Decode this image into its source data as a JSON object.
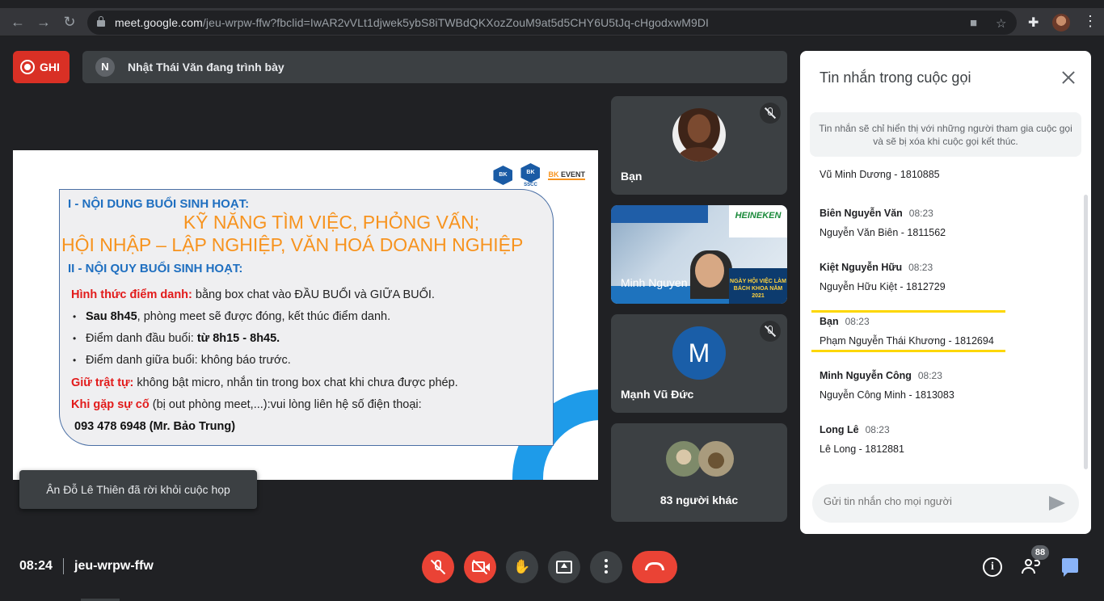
{
  "browser": {
    "url_host": "meet.google.com",
    "url_path": "/jeu-wrpw-ffw?fbclid=IwAR2vVLt1djwek5ybS8iTWBdQKXozZouM9at5d5CHY6U5tJq-cHgodxwM9DI"
  },
  "topbar": {
    "record_label": "GHI",
    "presenter_initial": "N",
    "presenter_text": "Nhật Thái Văn đang trình bày"
  },
  "slide": {
    "logo_bk": "BK",
    "logo_sscc": "SSCC",
    "logo_event_prefix": "BK",
    "logo_event_suffix": "EVENT",
    "heading1": "I - NỘI DUNG BUỔI SINH HOẠT:",
    "title_line1": "KỸ NĂNG TÌM VIỆC, PHỎNG VẤN;",
    "title_line2": "HỘI NHẬP – LẬP NGHIỆP, VĂN HOÁ DOANH NGHIỆP",
    "heading2": "II - NỘI QUY BUỔI SINH HOẠT:",
    "line1_red": "Hình thức điểm danh:",
    "line1_rest": " bằng box chat vào ĐẦU BUỔI và GIỮA BUỔI.",
    "bullet1_bold": "Sau 8h45",
    "bullet1_rest": ", phòng meet sẽ được đóng, kết thúc điểm danh.",
    "bullet2_pre": "Điểm danh đầu buổi: ",
    "bullet2_bold": "từ 8h15 - 8h45.",
    "bullet3": "Điểm danh giữa buổi: không báo trước.",
    "line2_red": "Giữ trật tự:",
    "line2_rest": " không bật micro, nhắn tin trong box chat khi chưa được phép.",
    "line3_red": "Khi gặp sự cố",
    "line3_rest": " (bị out phòng meet,...):vui lòng liên hệ số điện thoại:",
    "phone": "093 478 6948 (Mr. Bảo Trung)"
  },
  "toast": "Ân Đỗ Lê Thiên đã rời khỏi cuộc họp",
  "tiles": {
    "self_name": "Bạn",
    "video_name": "Minh Nguyen",
    "video_banner": "HEINEKEN",
    "video_poster": "NGÀY HỘI VIỆC LÀM BÁCH KHOA NĂM 2021",
    "m_initial": "M",
    "m_name": "Mạnh Vũ Đức",
    "others": "83 người khác"
  },
  "chat": {
    "title": "Tin nhắn trong cuộc gọi",
    "notice": "Tin nhắn sẽ chỉ hiển thị với những người tham gia cuộc gọi và sẽ bị xóa khi cuộc gọi kết thúc.",
    "messages": [
      {
        "sender": "",
        "time": "",
        "text": "Vũ Minh Dương - 1810885"
      },
      {
        "sender": "Biên Nguyễn Văn",
        "time": "08:23",
        "text": "Nguyễn Văn Biên - 1811562"
      },
      {
        "sender": "Kiệt Nguyễn Hữu",
        "time": "08:23",
        "text": "Nguyễn Hữu Kiệt - 1812729"
      },
      {
        "sender": "Bạn",
        "time": "08:23",
        "text": "Phạm Nguyễn Thái Khương - 1812694"
      },
      {
        "sender": "Minh Nguyễn Công",
        "time": "08:23",
        "text": "Nguyễn Công Minh - 1813083"
      },
      {
        "sender": "Long Lê",
        "time": "08:23",
        "text": "Lê Long - 1812881"
      }
    ],
    "input_placeholder": "Gửi tin nhắn cho mọi người"
  },
  "bottombar": {
    "time": "08:24",
    "meeting_code": "jeu-wrpw-ffw",
    "people_count": "88"
  },
  "colors": {
    "accent_red": "#ea4335",
    "highlight_yellow": "#fdd700",
    "chat_blue": "#8ab4f8"
  }
}
